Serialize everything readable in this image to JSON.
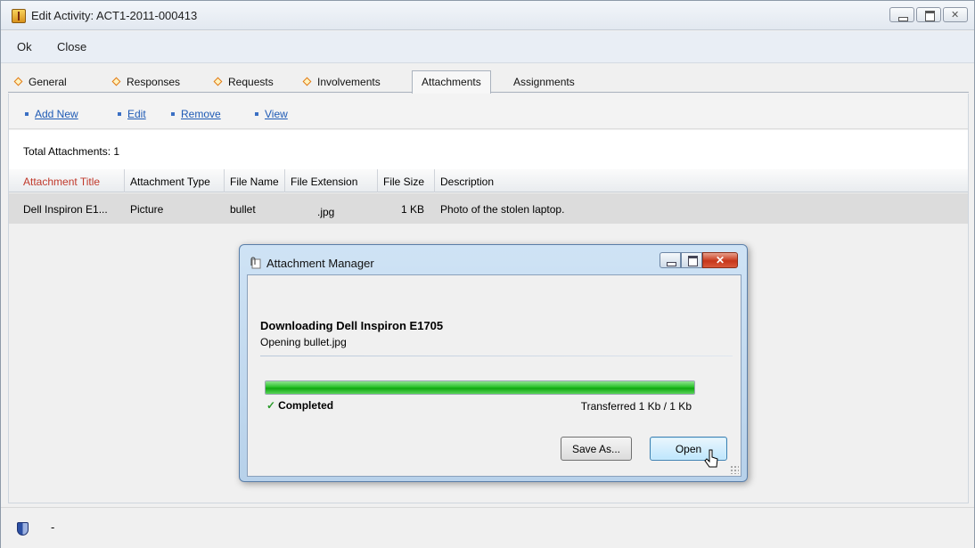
{
  "window": {
    "title": "Edit Activity: ACT1-2011-000413",
    "controls": [
      "minimize-icon",
      "maximize-icon",
      "close-icon"
    ]
  },
  "menu": {
    "ok_label": "Ok",
    "close_label": "Close"
  },
  "tabs": [
    {
      "label": "General",
      "has_indicator": true
    },
    {
      "label": "Responses",
      "has_indicator": true
    },
    {
      "label": "Requests",
      "has_indicator": true
    },
    {
      "label": "Involvements",
      "has_indicator": true
    },
    {
      "label": "Attachments",
      "active": true
    },
    {
      "label": "Assignments"
    }
  ],
  "actions": {
    "add_new": "Add New",
    "edit": "Edit",
    "remove": "Remove",
    "view": "View"
  },
  "summary": {
    "total_label": "Total Attachments: 1"
  },
  "table": {
    "columns": [
      "Attachment Title",
      "Attachment Type",
      "File Name",
      "File Extension",
      "File Size",
      "Description"
    ],
    "rows": [
      [
        "Dell Inspiron E1...",
        "Picture",
        "bullet",
        ".jpg",
        "1 KB",
        "Photo of the stolen laptop."
      ]
    ]
  },
  "status": {
    "text": "-"
  },
  "dialog": {
    "title": "Attachment Manager",
    "heading": "Downloading Dell Inspiron E1705",
    "subtext": "Opening bullet.jpg",
    "progress": 1.0,
    "status_label": "Completed",
    "transfer_label": "Transferred 1 Kb / 1 Kb",
    "save_as_label": "Save As...",
    "open_label": "Open"
  },
  "colors": {
    "accent": "#1e5ab5",
    "sorted_column": "#c0392b",
    "progress": "#2bc22b",
    "tab_indicator": "#e07a16"
  }
}
